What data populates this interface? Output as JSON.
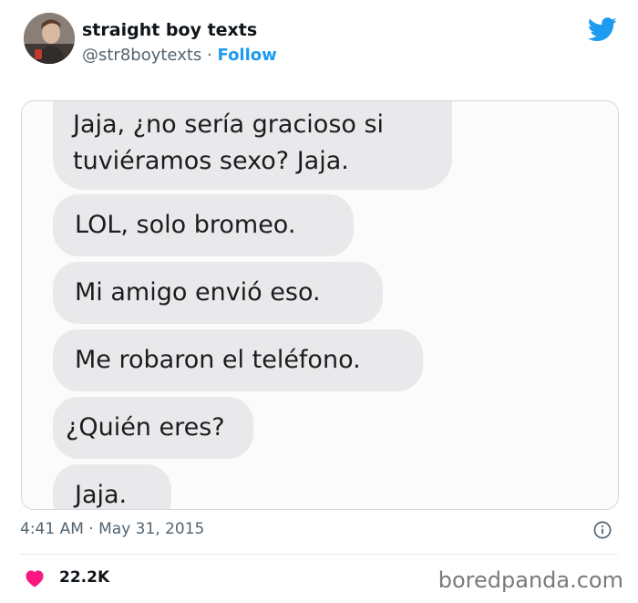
{
  "account": {
    "display_name": "straight boy texts",
    "handle": "@str8boytexts",
    "separator": "·",
    "follow_label": "Follow"
  },
  "messages": [
    {
      "text": "Jaja, ¿no sería gracioso si tuviéramos sexo? Jaja."
    },
    {
      "text": "LOL, solo bromeo."
    },
    {
      "text": "Mi amigo envió eso."
    },
    {
      "text": "Me robaron el teléfono."
    },
    {
      "text": "¿Quién eres?"
    },
    {
      "text": "Jaja."
    }
  ],
  "tweet_meta": {
    "time": "4:41 AM",
    "separator": "·",
    "date": "May 31, 2015"
  },
  "engagement": {
    "likes": "22.2K"
  },
  "watermark": "boredpanda.com",
  "icons": {
    "brand": "twitter-bird-icon",
    "info": "info-icon",
    "like": "heart-icon"
  },
  "colors": {
    "accent": "#1d9bf0",
    "like": "#f91880",
    "bubble": "#e9e9eb",
    "muted_text": "#536471"
  }
}
